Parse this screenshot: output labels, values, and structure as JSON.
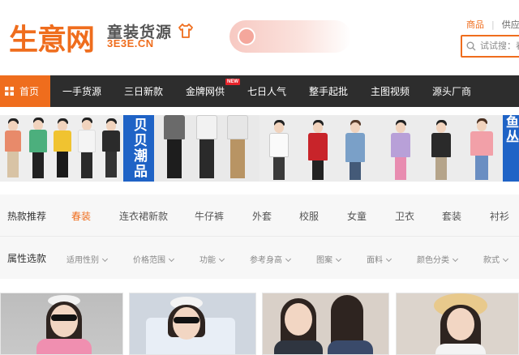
{
  "header": {
    "logo_text": "生意网",
    "logo_domain": "3E3E.CN",
    "logo_title": "童装货源",
    "search_tabs": [
      "商品",
      "供应"
    ],
    "search_placeholder": "试试搜：春"
  },
  "nav": {
    "home": "首页",
    "items": [
      "一手货源",
      "三日新款",
      "金牌网供",
      "七日人气",
      "整手起批",
      "主图视频",
      "源头厂商"
    ],
    "new_badge": "NEW"
  },
  "banner": {
    "tag_left": "贝贝潮品",
    "tag_right": "鱼丛"
  },
  "filters": {
    "hot_label": "热款推荐",
    "categories": [
      "春装",
      "连衣裙新款",
      "牛仔裤",
      "外套",
      "校服",
      "女童",
      "卫衣",
      "套装",
      "衬衫"
    ],
    "attr_label": "属性选款",
    "attributes": [
      "适用性别",
      "价格范围",
      "功能",
      "参考身高",
      "图案",
      "面料",
      "颜色分类",
      "款式"
    ]
  },
  "colors": {
    "accent": "#ef6d1d",
    "nav_bg": "#2d2d2d",
    "tag_blue": "#1f63c6"
  }
}
